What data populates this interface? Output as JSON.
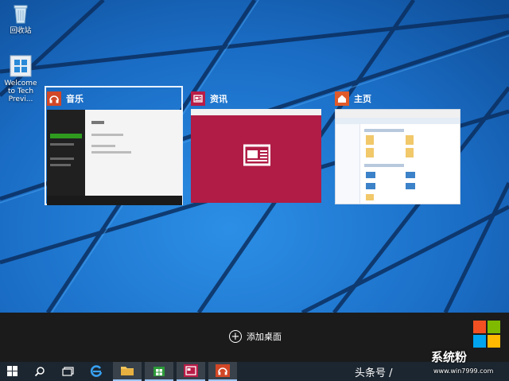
{
  "desktop": {
    "icons": [
      {
        "label": "回收站",
        "icon": "recycle-bin-icon"
      },
      {
        "label": "Welcome to Tech Previ...",
        "icon": "windows-logo-icon"
      }
    ]
  },
  "task_view": {
    "windows": [
      {
        "title": "音乐",
        "icon": "headphones-icon",
        "accent": "#d24726",
        "selected": true
      },
      {
        "title": "资讯",
        "icon": "news-icon",
        "accent": "#b91d47",
        "selected": false
      },
      {
        "title": "主页",
        "icon": "home-icon",
        "accent": "#e05a2a",
        "selected": false
      }
    ],
    "news_color": "#b01c45",
    "add_desktop_label": "添加桌面"
  },
  "taskbar": {
    "buttons": [
      {
        "name": "start",
        "icon": "windows-logo-icon"
      },
      {
        "name": "search",
        "icon": "search-icon"
      },
      {
        "name": "task-view",
        "icon": "task-view-icon"
      },
      {
        "name": "internet-explorer",
        "icon": "ie-icon"
      },
      {
        "name": "file-explorer",
        "icon": "folder-icon"
      },
      {
        "name": "store",
        "icon": "store-icon"
      },
      {
        "name": "news",
        "icon": "news-icon"
      },
      {
        "name": "music",
        "icon": "headphones-icon"
      }
    ],
    "color": "#1c2630"
  },
  "overlay": {
    "caption": "头条号 /",
    "watermark_text": "系统粉",
    "watermark_url": "www.win7999.com"
  }
}
